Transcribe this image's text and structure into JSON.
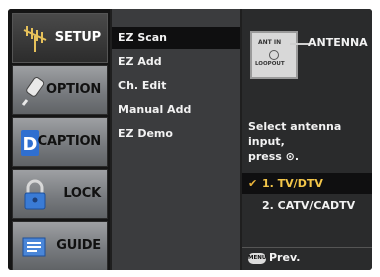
{
  "categories": [
    {
      "label": "SETUP",
      "icon": "antenna-icon",
      "active": true
    },
    {
      "label": "OPTION",
      "icon": "option-icon",
      "active": false
    },
    {
      "label": "CAPTION",
      "icon": "caption-icon",
      "active": false
    },
    {
      "label": "LOCK",
      "icon": "lock-icon",
      "active": false
    },
    {
      "label": "GUIDE",
      "icon": "guide-icon",
      "active": false
    }
  ],
  "items": [
    "EZ Scan",
    "EZ Add",
    "Ch. Edit",
    "Manual Add",
    "EZ Demo"
  ],
  "detail": {
    "antenna_label": "ANTENNA",
    "jack_top": "ANT IN",
    "jack_bottom": "LOOPOUT",
    "instruction_line1": "Select antenna input,",
    "instruction_line2": "press ⊙.",
    "options": [
      {
        "label": "1. TV/DTV",
        "selected": true
      },
      {
        "label": "2. CATV/CADTV",
        "selected": false
      }
    ],
    "menu_key": "MENU",
    "prev_label": "Prev."
  },
  "colors": {
    "highlight_text": "#f3c64a",
    "check": "#e8b23a"
  }
}
